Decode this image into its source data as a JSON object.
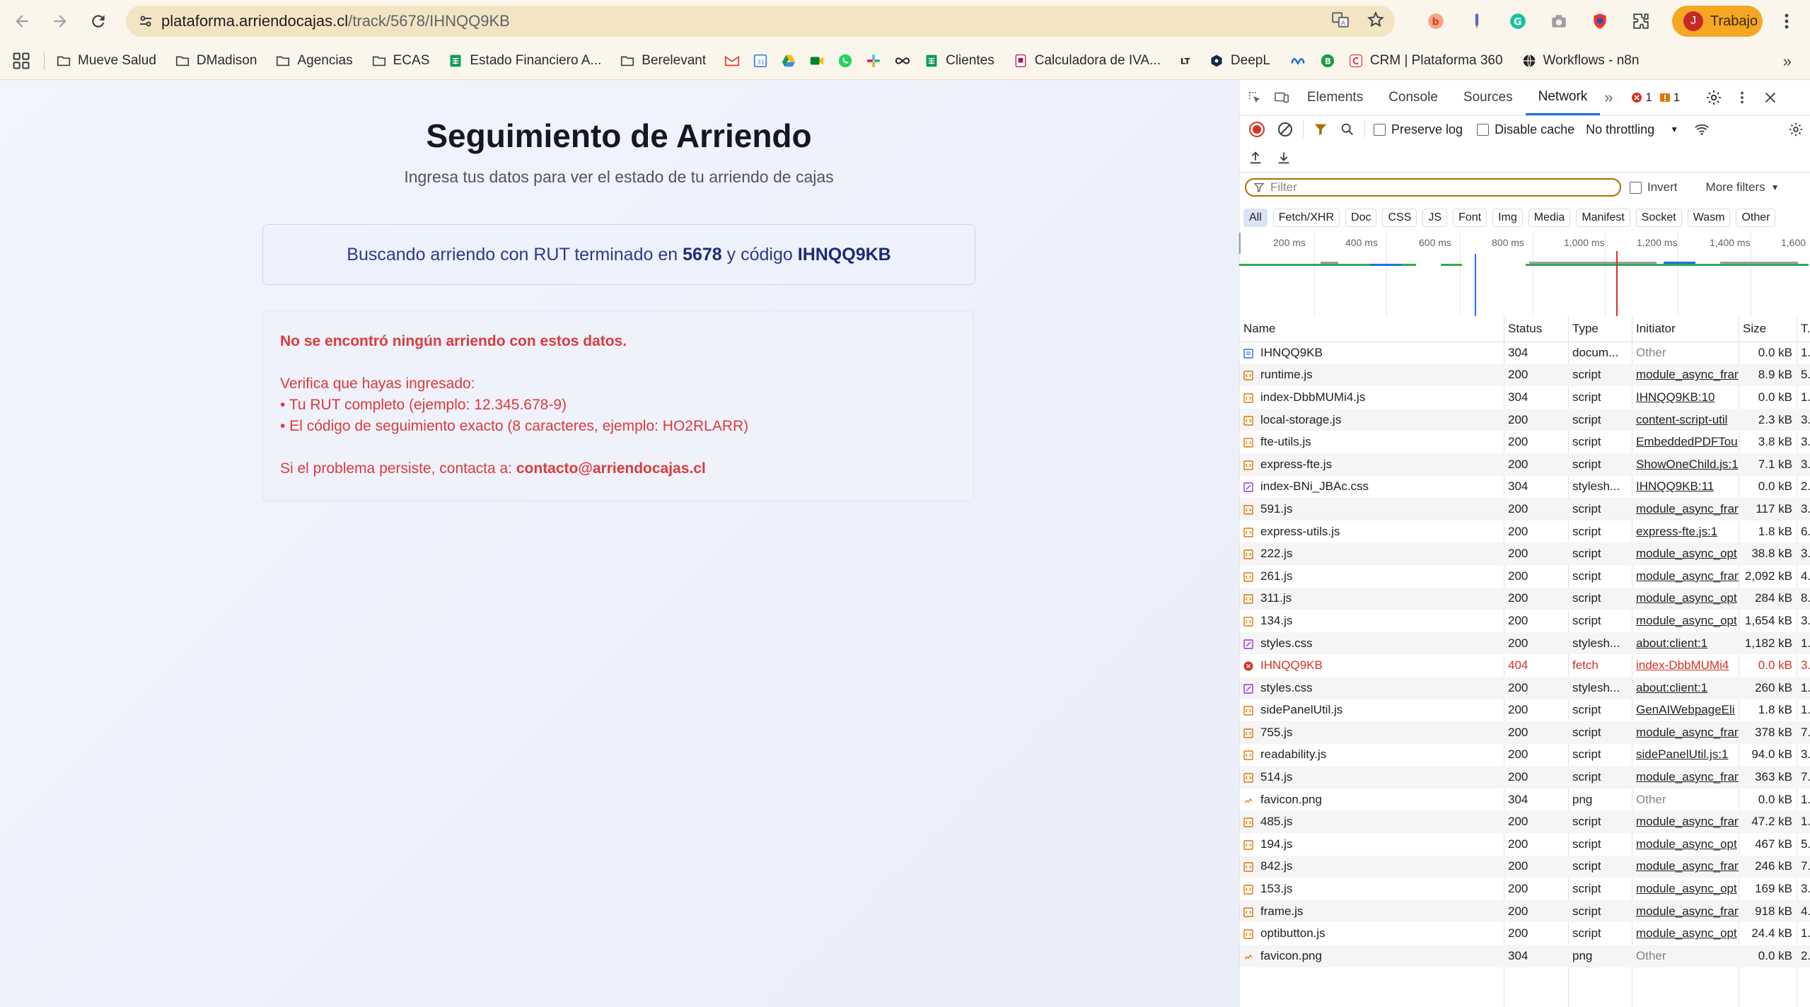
{
  "browser": {
    "url_host": "plataforma.arriendocajas.cl",
    "url_path": "/track/5678/IHNQQ9KB",
    "profile_initial": "J",
    "profile_label": "Trabajo"
  },
  "bookmarks": [
    {
      "label": "Mueve Salud",
      "icon": "folder-icon"
    },
    {
      "label": "DMadison",
      "icon": "folder-icon"
    },
    {
      "label": "Agencias",
      "icon": "folder-icon"
    },
    {
      "label": "ECAS",
      "icon": "folder-icon"
    },
    {
      "label": "Estado Financiero A...",
      "icon": "sheets-icon"
    },
    {
      "label": "Berelevant",
      "icon": "folder-icon"
    },
    {
      "label": "Clientes",
      "icon": "sheets-icon"
    },
    {
      "label": "Calculadora de IVA...",
      "icon": "doc-icon"
    },
    {
      "label": "DeepL",
      "icon": "deepl-icon"
    },
    {
      "label": "CRM | Plataforma 360",
      "icon": "crm-icon"
    },
    {
      "label": "Workflows - n8n",
      "icon": "globe-icon"
    }
  ],
  "page": {
    "title": "Seguimiento de Arriendo",
    "subtitle": "Ingresa tus datos para ver el estado de tu arriendo de cajas",
    "search_prefix": "Buscando arriendo con RUT terminado en",
    "search_rut": "5678",
    "search_middle": "y código",
    "search_code": "IHNQQ9KB",
    "error_title": "No se encontró ningún arriendo con estos datos.",
    "error_verify": "Verifica que hayas ingresado:",
    "error_bullet1": "• Tu RUT completo (ejemplo: 12.345.678-9)",
    "error_bullet2": "• El código de seguimiento exacto (8 caracteres, ejemplo: HO2RLARR)",
    "error_contact_prefix": "Si el problema persiste, contacta a:",
    "error_contact_email": "contacto@arriendocajas.cl"
  },
  "devtools": {
    "tabs": [
      "Elements",
      "Console",
      "Sources",
      "Network"
    ],
    "active_tab": "Network",
    "errors_count": "1",
    "warnings_count": "1",
    "preserve_log": "Preserve log",
    "disable_cache": "Disable cache",
    "throttling": "No throttling",
    "filter_placeholder": "Filter",
    "invert": "Invert",
    "more_filters": "More filters",
    "type_filters": [
      "All",
      "Fetch/XHR",
      "Doc",
      "CSS",
      "JS",
      "Font",
      "Img",
      "Media",
      "Manifest",
      "Socket",
      "Wasm",
      "Other"
    ],
    "timeline_labels": [
      "200 ms",
      "400 ms",
      "600 ms",
      "800 ms",
      "1,000 ms",
      "1,200 ms",
      "1,400 ms",
      "1,600"
    ],
    "columns": [
      "Name",
      "Status",
      "Type",
      "Initiator",
      "Size",
      "T."
    ],
    "requests": [
      {
        "name": "IHNQQ9KB",
        "status": "304",
        "type": "docum...",
        "initiator": "Other",
        "size": "0.0 kB",
        "time": "1.",
        "kind": "doc"
      },
      {
        "name": "runtime.js",
        "status": "200",
        "type": "script",
        "initiator": "module_async_fran",
        "size": "8.9 kB",
        "time": "5.",
        "kind": "js"
      },
      {
        "name": "index-DbbMUMi4.js",
        "status": "304",
        "type": "script",
        "initiator": "IHNQQ9KB:10",
        "size": "0.0 kB",
        "time": "1.",
        "kind": "js"
      },
      {
        "name": "local-storage.js",
        "status": "200",
        "type": "script",
        "initiator": "content-script-util",
        "size": "2.3 kB",
        "time": "3.",
        "kind": "js"
      },
      {
        "name": "fte-utils.js",
        "status": "200",
        "type": "script",
        "initiator": "EmbeddedPDFTou",
        "size": "3.8 kB",
        "time": "3.",
        "kind": "js"
      },
      {
        "name": "express-fte.js",
        "status": "200",
        "type": "script",
        "initiator": "ShowOneChild.js:1",
        "size": "7.1 kB",
        "time": "3.",
        "kind": "js"
      },
      {
        "name": "index-BNi_JBAc.css",
        "status": "304",
        "type": "stylesh...",
        "initiator": "IHNQQ9KB:11",
        "size": "0.0 kB",
        "time": "2.",
        "kind": "css"
      },
      {
        "name": "591.js",
        "status": "200",
        "type": "script",
        "initiator": "module_async_fran",
        "size": "117 kB",
        "time": "3.",
        "kind": "js"
      },
      {
        "name": "express-utils.js",
        "status": "200",
        "type": "script",
        "initiator": "express-fte.js:1",
        "size": "1.8 kB",
        "time": "6.",
        "kind": "js"
      },
      {
        "name": "222.js",
        "status": "200",
        "type": "script",
        "initiator": "module_async_opt",
        "size": "38.8 kB",
        "time": "3.",
        "kind": "js"
      },
      {
        "name": "261.js",
        "status": "200",
        "type": "script",
        "initiator": "module_async_fran",
        "size": "2,092 kB",
        "time": "4.",
        "kind": "js"
      },
      {
        "name": "311.js",
        "status": "200",
        "type": "script",
        "initiator": "module_async_opt",
        "size": "284 kB",
        "time": "8.",
        "kind": "js"
      },
      {
        "name": "134.js",
        "status": "200",
        "type": "script",
        "initiator": "module_async_opt",
        "size": "1,654 kB",
        "time": "3.",
        "kind": "js"
      },
      {
        "name": "styles.css",
        "status": "200",
        "type": "stylesh...",
        "initiator": "about:client:1",
        "size": "1,182 kB",
        "time": "1.",
        "kind": "css"
      },
      {
        "name": "IHNQQ9KB",
        "status": "404",
        "type": "fetch",
        "initiator": "index-DbbMUMi4",
        "size": "0.0 kB",
        "time": "3.",
        "kind": "error"
      },
      {
        "name": "styles.css",
        "status": "200",
        "type": "stylesh...",
        "initiator": "about:client:1",
        "size": "260 kB",
        "time": "1.",
        "kind": "css"
      },
      {
        "name": "sidePanelUtil.js",
        "status": "200",
        "type": "script",
        "initiator": "GenAIWebpageEli",
        "size": "1.8 kB",
        "time": "1.",
        "kind": "js"
      },
      {
        "name": "755.js",
        "status": "200",
        "type": "script",
        "initiator": "module_async_fran",
        "size": "378 kB",
        "time": "7.",
        "kind": "js"
      },
      {
        "name": "readability.js",
        "status": "200",
        "type": "script",
        "initiator": "sidePanelUtil.js:1",
        "size": "94.0 kB",
        "time": "3.",
        "kind": "js"
      },
      {
        "name": "514.js",
        "status": "200",
        "type": "script",
        "initiator": "module_async_fran",
        "size": "363 kB",
        "time": "7.",
        "kind": "js"
      },
      {
        "name": "favicon.png",
        "status": "304",
        "type": "png",
        "initiator": "Other",
        "size": "0.0 kB",
        "time": "1.",
        "kind": "img"
      },
      {
        "name": "485.js",
        "status": "200",
        "type": "script",
        "initiator": "module_async_fran",
        "size": "47.2 kB",
        "time": "1.",
        "kind": "js"
      },
      {
        "name": "194.js",
        "status": "200",
        "type": "script",
        "initiator": "module_async_opt",
        "size": "467 kB",
        "time": "5.",
        "kind": "js"
      },
      {
        "name": "842.js",
        "status": "200",
        "type": "script",
        "initiator": "module_async_fran",
        "size": "246 kB",
        "time": "7.",
        "kind": "js"
      },
      {
        "name": "153.js",
        "status": "200",
        "type": "script",
        "initiator": "module_async_opt",
        "size": "169 kB",
        "time": "3.",
        "kind": "js"
      },
      {
        "name": "frame.js",
        "status": "200",
        "type": "script",
        "initiator": "module_async_fran",
        "size": "918 kB",
        "time": "4.",
        "kind": "js"
      },
      {
        "name": "optibutton.js",
        "status": "200",
        "type": "script",
        "initiator": "module_async_opt",
        "size": "24.4 kB",
        "time": "1.",
        "kind": "js"
      },
      {
        "name": "favicon.png",
        "status": "304",
        "type": "png",
        "initiator": "Other",
        "size": "0.0 kB",
        "time": "2.",
        "kind": "img"
      }
    ]
  }
}
